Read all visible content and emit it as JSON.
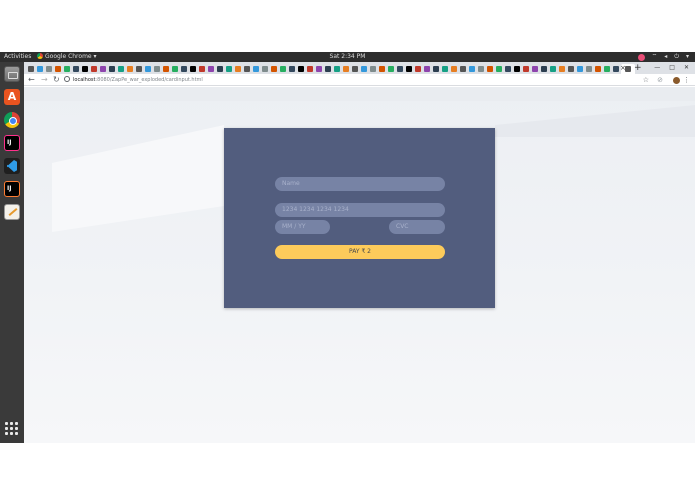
{
  "system_bar": {
    "activities": "Activities",
    "app_menu": "Google Chrome ▾",
    "clock": "Sat  2:34 PM"
  },
  "browser": {
    "url_host": "localhost",
    "url_path": ":8080/ZapPe_war_exploded/cardinput.html",
    "new_tab_label": "+",
    "tab_close_label": "×"
  },
  "form": {
    "name_placeholder": "Name",
    "card_number_placeholder": "1234 1234 1234 1234",
    "expiry_placeholder": "MM / YY",
    "cvc_placeholder": "CVC",
    "pay_button_label": "PAY ₹ 2"
  },
  "colors": {
    "card_background": "#525d7e",
    "input_background": "#7783a5",
    "pay_button": "#fdcb5b",
    "page_background": "#eceff3"
  },
  "icons": [
    "files-icon",
    "ubuntu-software-icon",
    "chrome-icon",
    "intellij-icon",
    "vscode-icon",
    "text-editor-icon",
    "show-apps-icon"
  ]
}
